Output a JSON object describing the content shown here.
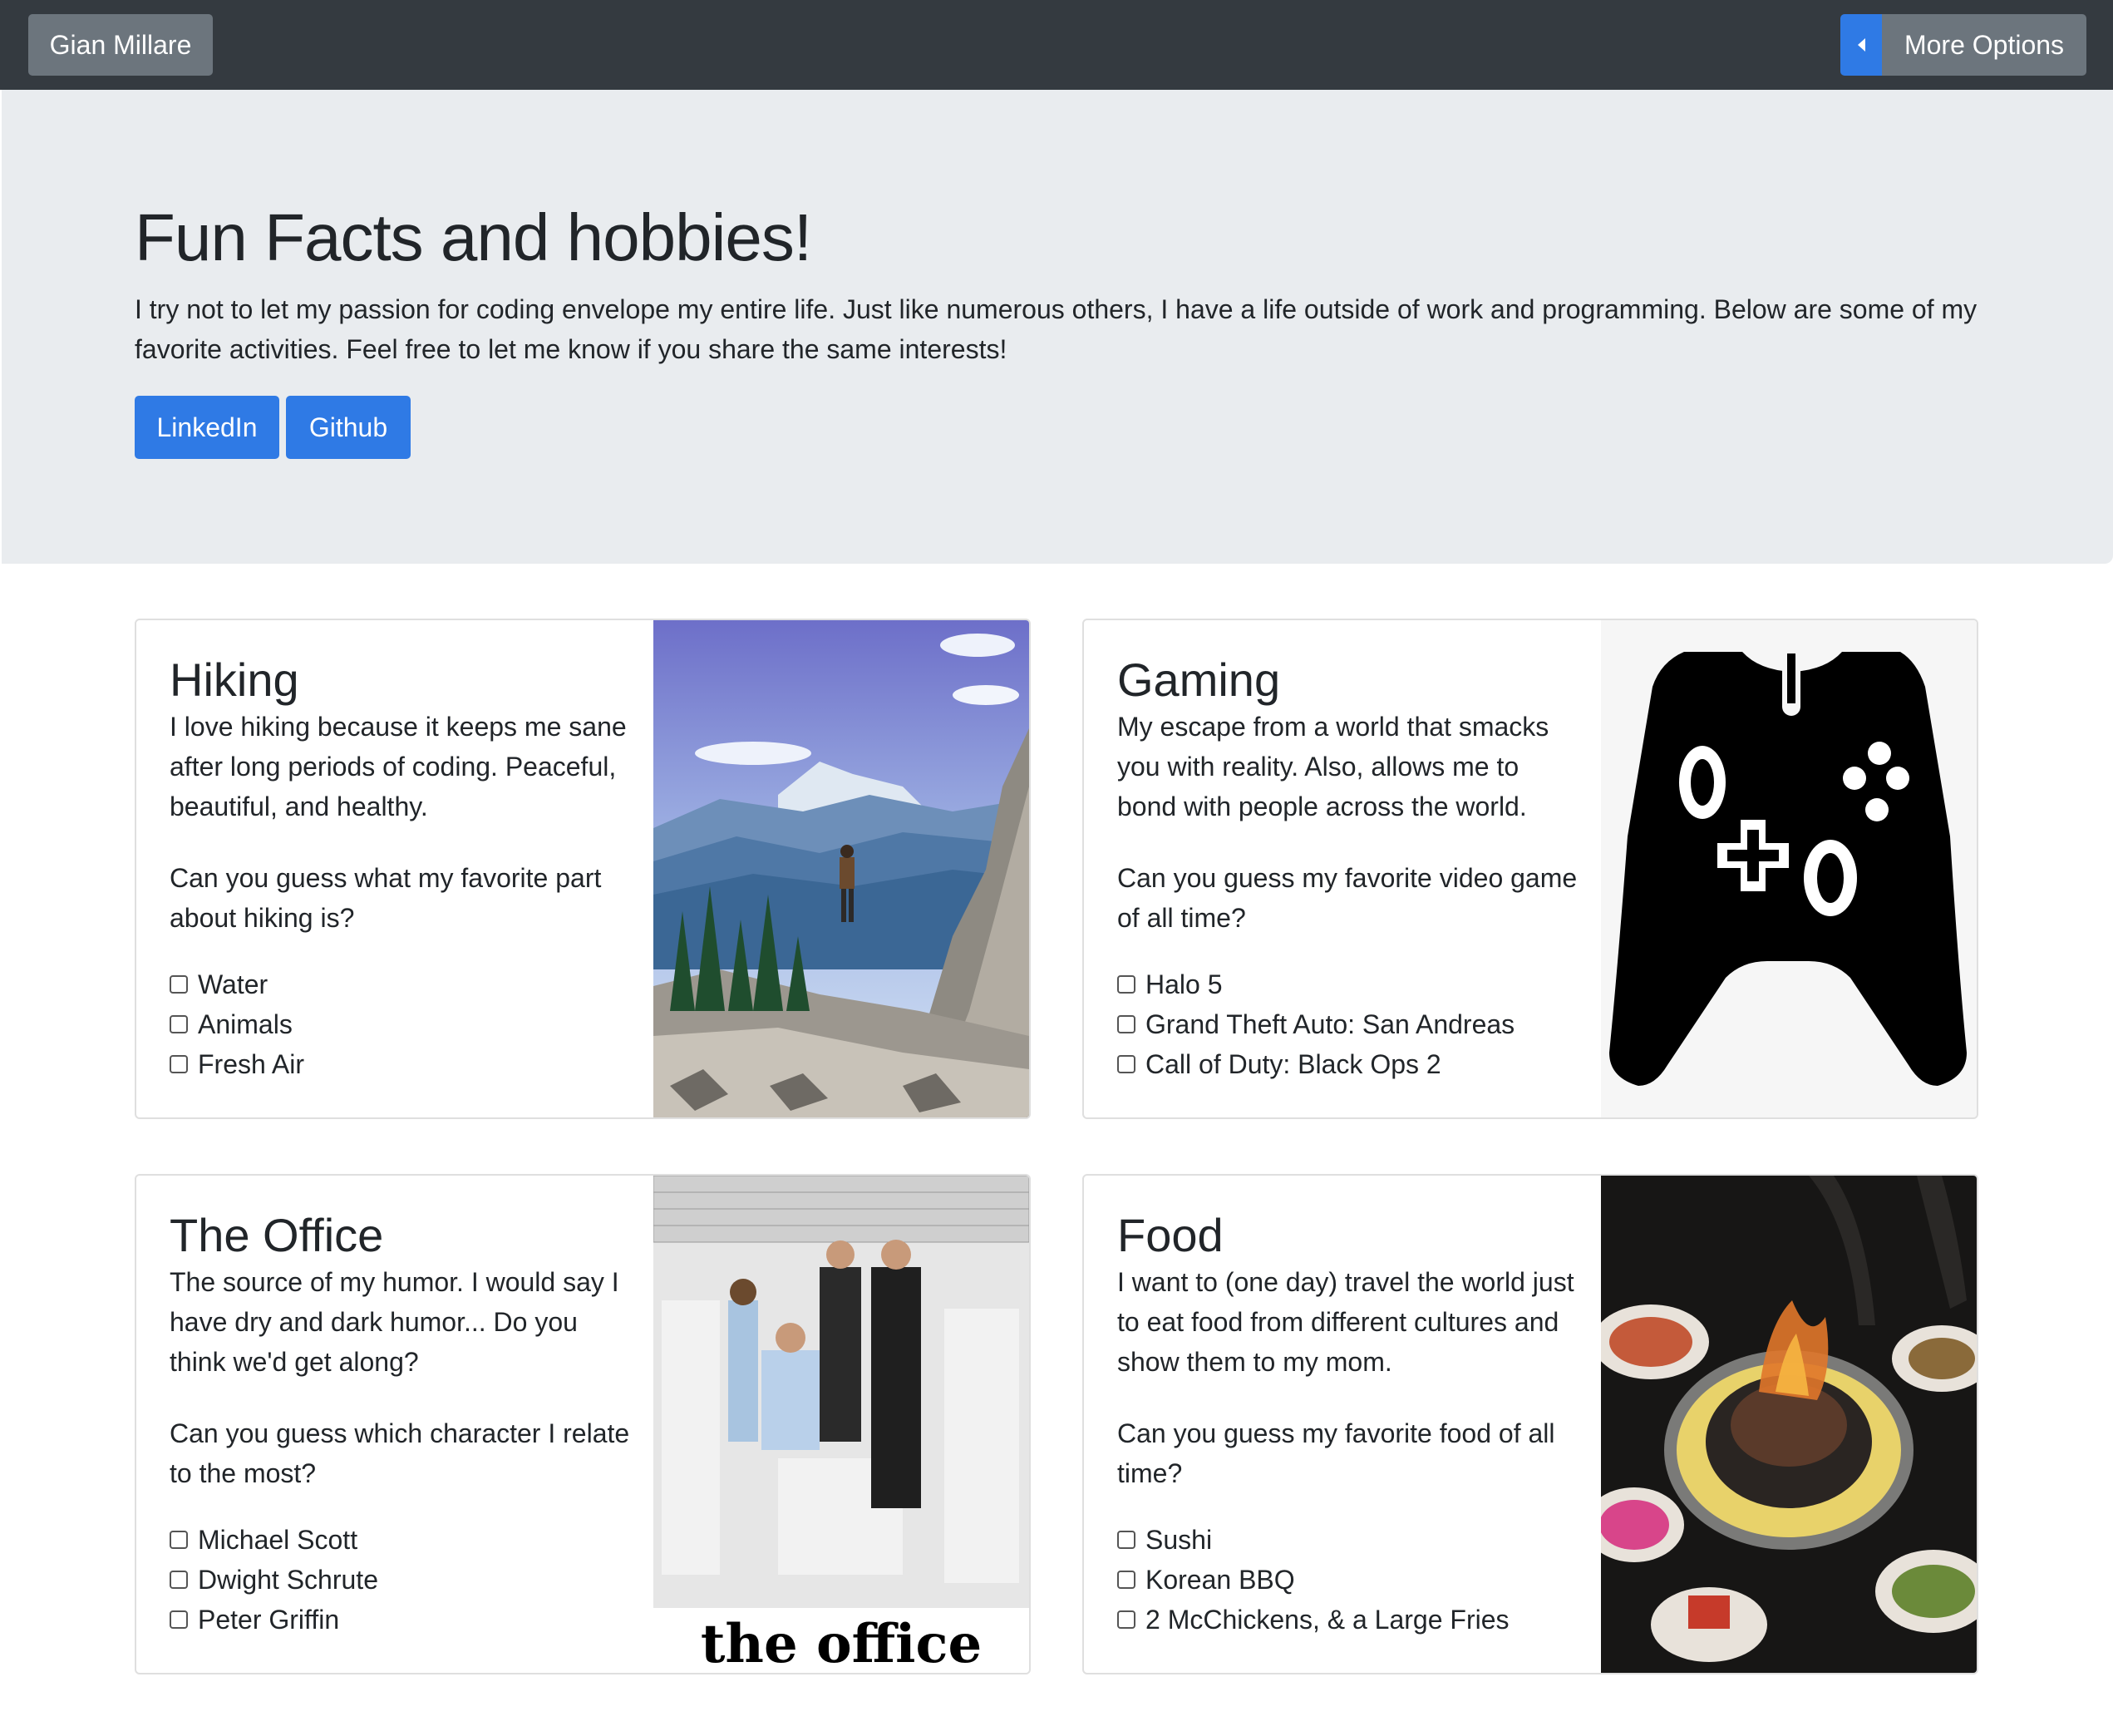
{
  "navbar": {
    "brand": "Gian Millare",
    "more_options": "More Options"
  },
  "jumbotron": {
    "title": "Fun Facts and hobbies!",
    "text": "I try not to let my passion for coding envelope my entire life. Just like numerous others, I have a life outside of work and programming. Below are some of my favorite activities. Feel free to let me know if you share the same interests!",
    "buttons": [
      "LinkedIn",
      "Github"
    ]
  },
  "cards": [
    {
      "title": "Hiking",
      "text": "I love hiking because it keeps me sane after long periods of coding. Peaceful, beautiful, and healthy.",
      "question": "Can you guess what my favorite part about hiking is?",
      "options": [
        "Water",
        "Animals",
        "Fresh Air"
      ]
    },
    {
      "title": "Gaming",
      "text": "My escape from a world that smacks you with reality. Also, allows me to bond with people across the world.",
      "question": "Can you guess my favorite video game of all time?",
      "options": [
        "Halo 5",
        "Grand Theft Auto: San Andreas",
        "Call of Duty: Black Ops 2"
      ]
    },
    {
      "title": "The Office",
      "text": "The source of my humor. I would say I have dry and dark humor... Do you think we'd get along?",
      "question": "Can you guess which character I relate to the most?",
      "options": [
        "Michael Scott",
        "Dwight Schrute",
        "Peter Griffin"
      ],
      "image_text": "the office"
    },
    {
      "title": "Food",
      "text": "I want to (one day) travel the world just to eat food from different cultures and show them to my mom.",
      "question": "Can you guess my favorite food of all time?",
      "options": [
        "Sushi",
        "Korean BBQ",
        "2 McChickens, & a Large Fries"
      ]
    }
  ],
  "colors": {
    "navbar": "#343a40",
    "secondary": "#6c757d",
    "primary": "#2f7ae5",
    "jumbotron": "#e9ecef"
  },
  "icons": [
    "caret-left-icon",
    "game-controller-icon"
  ]
}
